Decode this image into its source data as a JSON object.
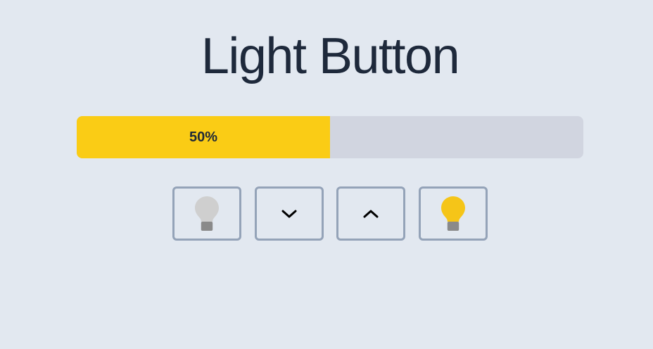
{
  "page": {
    "title": "Light Button"
  },
  "brightness": {
    "percent": 50,
    "label": "50%"
  },
  "controls": [
    {
      "name": "light-off-button",
      "icon": "lightbulb-off-icon"
    },
    {
      "name": "decrease-brightness-button",
      "icon": "chevron-down-icon"
    },
    {
      "name": "increase-brightness-button",
      "icon": "chevron-up-icon"
    },
    {
      "name": "light-on-button",
      "icon": "lightbulb-on-icon"
    }
  ],
  "colors": {
    "background": "#e2e8f0",
    "title": "#1e293b",
    "track": "#d1d5e0",
    "fill": "#facc15",
    "button_border": "#94a3b8",
    "bulb_off": "#cfcfcf",
    "bulb_on": "#f5c518",
    "bulb_base": "#8a8a8a"
  }
}
